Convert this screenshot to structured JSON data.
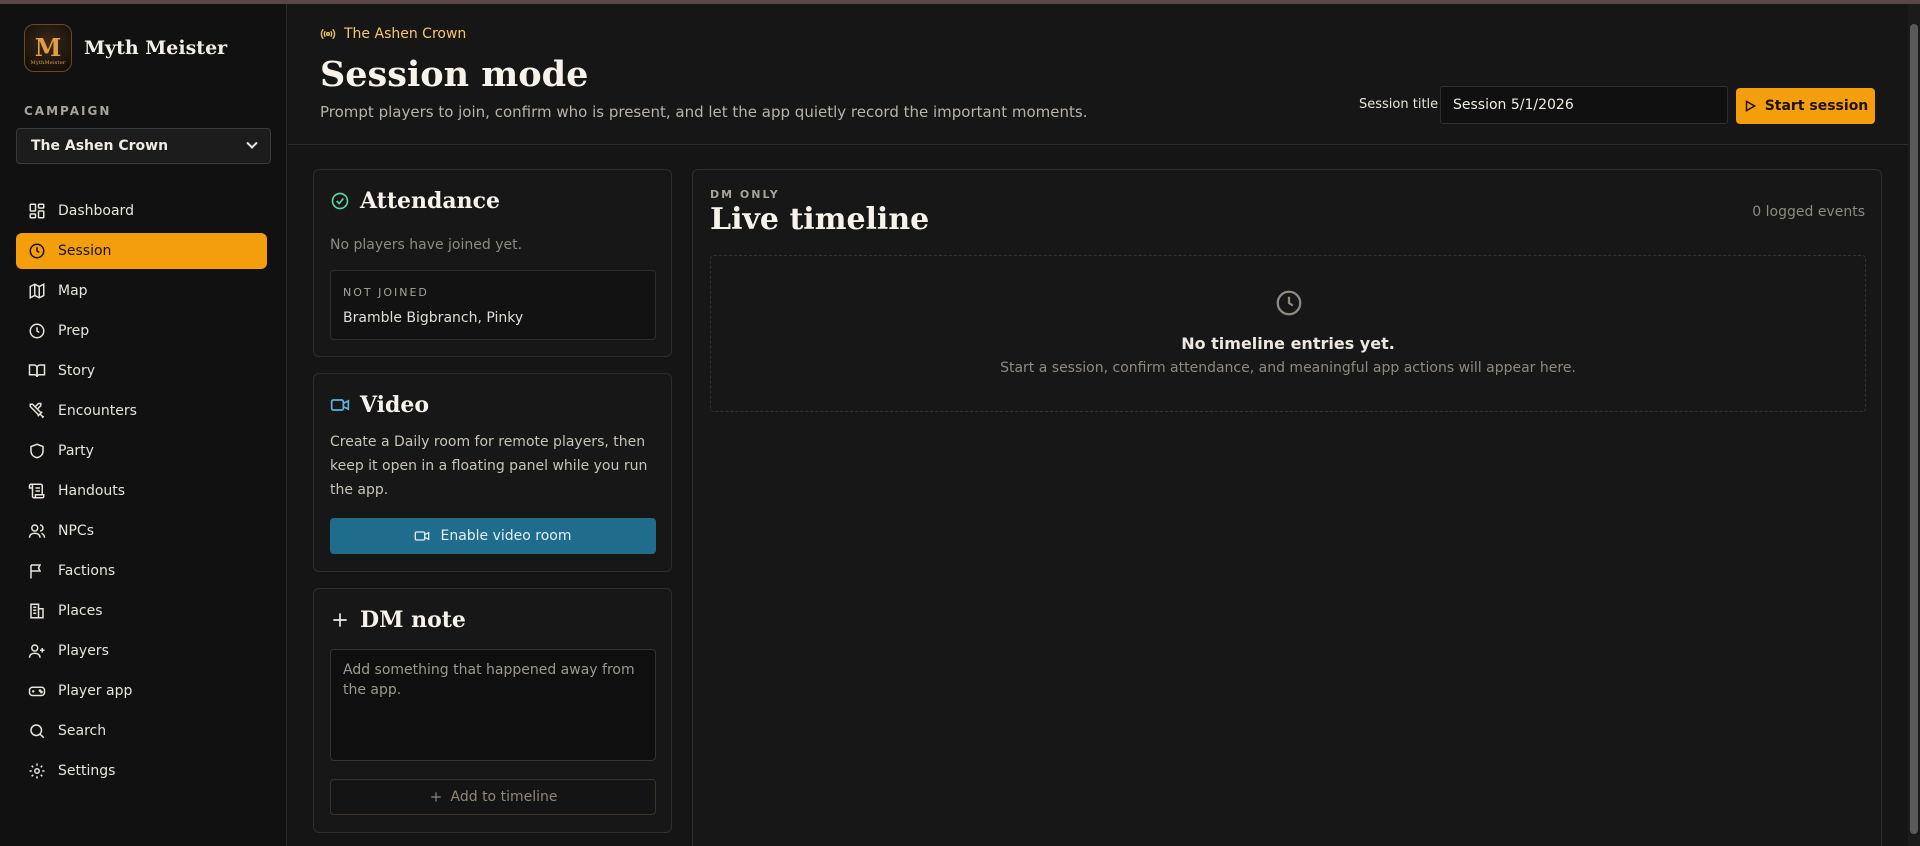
{
  "brand": {
    "name": "Myth Meister",
    "logo_letter": "M",
    "logo_caption": "MythMeister"
  },
  "campaign": {
    "label": "CAMPAIGN",
    "selected": "The Ashen Crown"
  },
  "nav": {
    "dashboard": "Dashboard",
    "session": "Session",
    "map": "Map",
    "prep": "Prep",
    "story": "Story",
    "encounters": "Encounters",
    "party": "Party",
    "handouts": "Handouts",
    "npcs": "NPCs",
    "factions": "Factions",
    "places": "Places",
    "players": "Players",
    "player_app": "Player app",
    "search": "Search",
    "settings": "Settings"
  },
  "header": {
    "crumb": "The Ashen Crown",
    "title": "Session mode",
    "subtitle": "Prompt players to join, confirm who is present, and let the app quietly record the important moments.",
    "session_label": "Session title",
    "session_value": "Session 5/1/2026",
    "start_label": "Start session"
  },
  "attendance": {
    "title": "Attendance",
    "empty": "No players have joined yet.",
    "not_joined_label": "NOT JOINED",
    "not_joined_value": "Bramble Bigbranch, Pinky"
  },
  "video": {
    "title": "Video",
    "description": "Create a Daily room for remote players, then keep it open in a floating panel while you run the app.",
    "button": "Enable video room"
  },
  "note": {
    "title": "DM note",
    "placeholder": "Add something that happened away from the app.",
    "button": "Add to timeline"
  },
  "timeline": {
    "tag": "DM ONLY",
    "title": "Live timeline",
    "count": "0 logged events",
    "empty_title": "No timeline entries yet.",
    "empty_text": "Start a session, confirm attendance, and meaningful app actions will appear here."
  },
  "colors": {
    "accent": "#f59e0b",
    "video": "#1f6c8d",
    "background": "#151515"
  }
}
